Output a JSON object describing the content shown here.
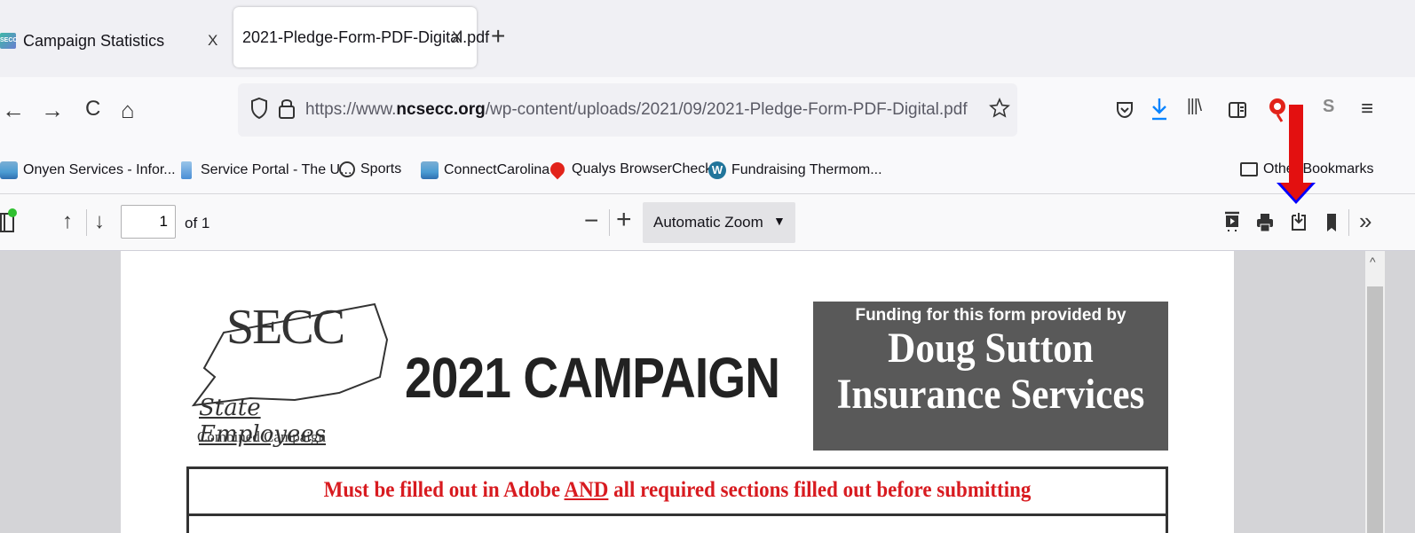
{
  "tabs": [
    {
      "title": "Campaign Statistics",
      "close": "X",
      "favicon": "SECC"
    },
    {
      "title": "2021-Pledge-Form-PDF-Digital.pdf",
      "close": "X"
    }
  ],
  "new_tab": "+",
  "nav": {
    "back": "←",
    "forward": "→",
    "reload": "C",
    "home": "⌂",
    "url_prefix": "https://www.",
    "url_domain": "ncsecc.org",
    "url_path": "/wp-content/uploads/2021/09/2021-Pledge-Form-PDF-Digital.pdf",
    "menu": "≡",
    "library": "|||\\",
    "s_icon": "S"
  },
  "bookmarks": [
    {
      "label": "Onyen Services - Infor...",
      "icon": "unc-icon"
    },
    {
      "label": "Service Portal - The U...",
      "icon": "portal-icon"
    },
    {
      "label": "Sports",
      "icon": "globe-icon"
    },
    {
      "label": "ConnectCarolina",
      "icon": "unc-icon"
    },
    {
      "label": "Qualys BrowserCheck",
      "icon": "qualys-icon"
    },
    {
      "label": "Fundraising Thermom...",
      "icon": "wordpress-icon"
    },
    {
      "label": "Other Bookmarks",
      "icon": "folder-icon"
    }
  ],
  "pdf_toolbar": {
    "page_number": "1",
    "page_of": "of 1",
    "zoom_minus": "−",
    "zoom_plus": "+",
    "zoom": "Automatic Zoom",
    "more": "»"
  },
  "document": {
    "logo_text": "SECC",
    "logo_script": "State Employees",
    "logo_sub": "Combined Campaign",
    "title": "2021 CAMPAIGN",
    "funding_line": "Funding for this form provided by",
    "funding_name_1": "Doug Sutton",
    "funding_name_2": "Insurance Services",
    "notice_pre": "Must be filled out in Adobe ",
    "notice_and": "AND",
    "notice_post": " all required sections filled out before submitting"
  },
  "colors": {
    "notice_red": "#d81b20",
    "arrow_red": "#e31010",
    "funding_bg": "#595959"
  }
}
